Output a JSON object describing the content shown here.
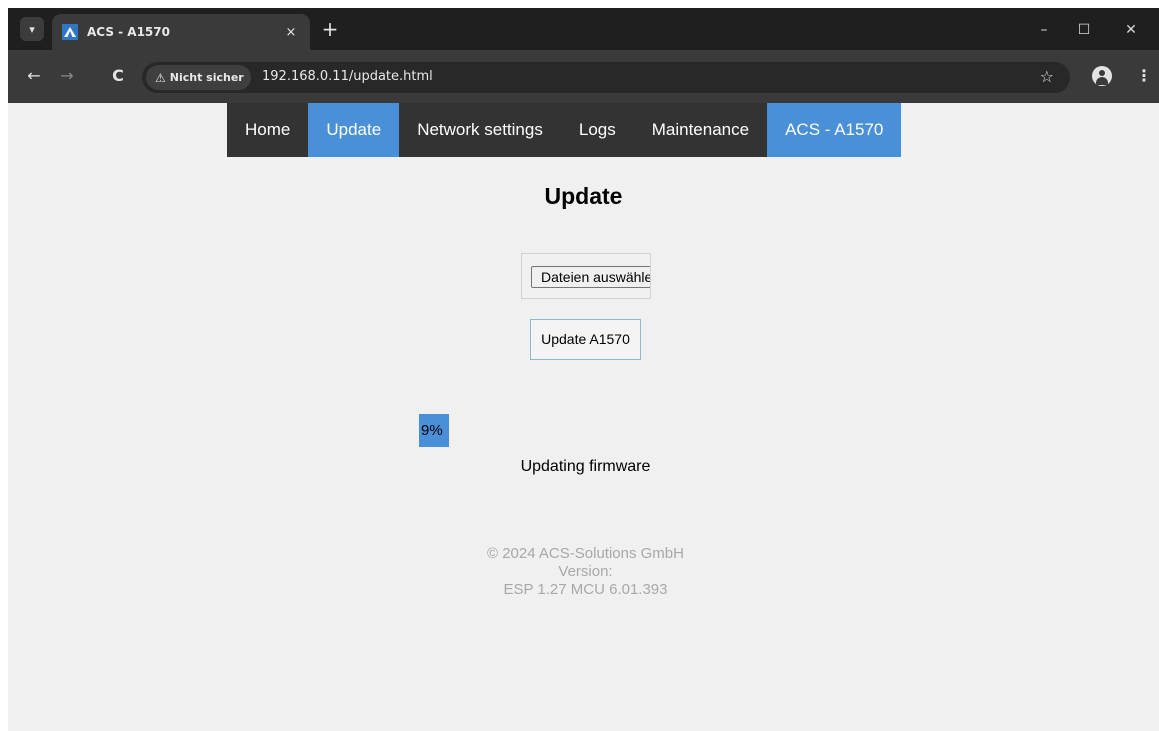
{
  "browser": {
    "tab": {
      "title": "ACS - A1570",
      "close_glyph": "×"
    },
    "new_tab_glyph": "+",
    "window_controls": {
      "minimize": "–",
      "maximize": "☐",
      "close": "✕"
    },
    "nav": {
      "back": "←",
      "forward": "→",
      "reload": "C"
    },
    "security_chip": {
      "warning_glyph": "⚠",
      "label": "Nicht sicher"
    },
    "url": "192.168.0.11/update.html",
    "bookmark_glyph": "☆",
    "menu_glyph": "⋮"
  },
  "topnav": {
    "items": [
      {
        "label": "Home"
      },
      {
        "label": "Update",
        "active": true
      },
      {
        "label": "Network settings"
      },
      {
        "label": "Logs"
      },
      {
        "label": "Maintenance"
      },
      {
        "label": "ACS - A1570"
      }
    ]
  },
  "page": {
    "title": "Update",
    "file_button_label": "Dateien auswählen",
    "update_button_label": "Update A1570",
    "progress": {
      "percent": 9,
      "label": "9%"
    },
    "status": "Updating firmware"
  },
  "footer": {
    "copyright": "© 2024 ACS-Solutions GmbH",
    "version_label": "Version:",
    "version_value": "ESP 1.27 MCU 6.01.393"
  },
  "colors": {
    "accent": "#4a90d9",
    "nav_bg": "#333333",
    "page_bg": "#f0f0f0",
    "footer_text": "#a8a8a8"
  }
}
